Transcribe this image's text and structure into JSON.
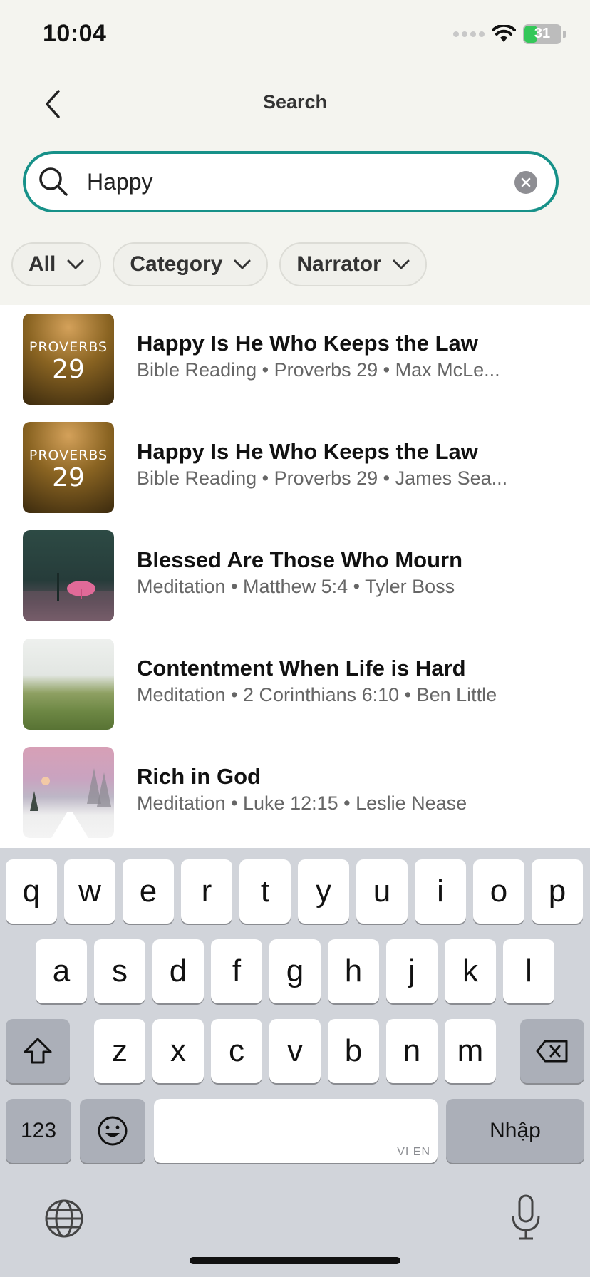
{
  "status": {
    "time": "10:04",
    "battery": "31"
  },
  "nav": {
    "title": "Search"
  },
  "search": {
    "value": "Happy",
    "placeholder": ""
  },
  "filters": [
    {
      "label": "All"
    },
    {
      "label": "Category"
    },
    {
      "label": "Narrator"
    }
  ],
  "results": [
    {
      "title": "Happy Is He Who Keeps the Law",
      "subtitle": "Bible Reading • Proverbs 29 • Max McLe...",
      "thumb_text": "PROVERBS",
      "thumb_num": "29"
    },
    {
      "title": "Happy Is He Who Keeps the Law",
      "subtitle": "Bible Reading • Proverbs 29 • James Sea...",
      "thumb_text": "PROVERBS",
      "thumb_num": "29"
    },
    {
      "title": "Blessed Are Those Who Mourn",
      "subtitle": "Meditation • Matthew 5:4 • Tyler Boss"
    },
    {
      "title": "Contentment When Life is Hard",
      "subtitle": "Meditation • 2 Corinthians 6:10 • Ben Little"
    },
    {
      "title": "Rich in God",
      "subtitle": "Meditation • Luke 12:15 • Leslie Nease"
    }
  ],
  "keyboard": {
    "row1": [
      "q",
      "w",
      "e",
      "r",
      "t",
      "y",
      "u",
      "i",
      "o",
      "p"
    ],
    "row2": [
      "a",
      "s",
      "d",
      "f",
      "g",
      "h",
      "j",
      "k",
      "l"
    ],
    "row3": [
      "z",
      "x",
      "c",
      "v",
      "b",
      "n",
      "m"
    ],
    "numbers": "123",
    "return": "Nhập",
    "space_hint": "VI EN"
  },
  "colors": {
    "accent": "#179189",
    "background": "#f4f4ef"
  }
}
